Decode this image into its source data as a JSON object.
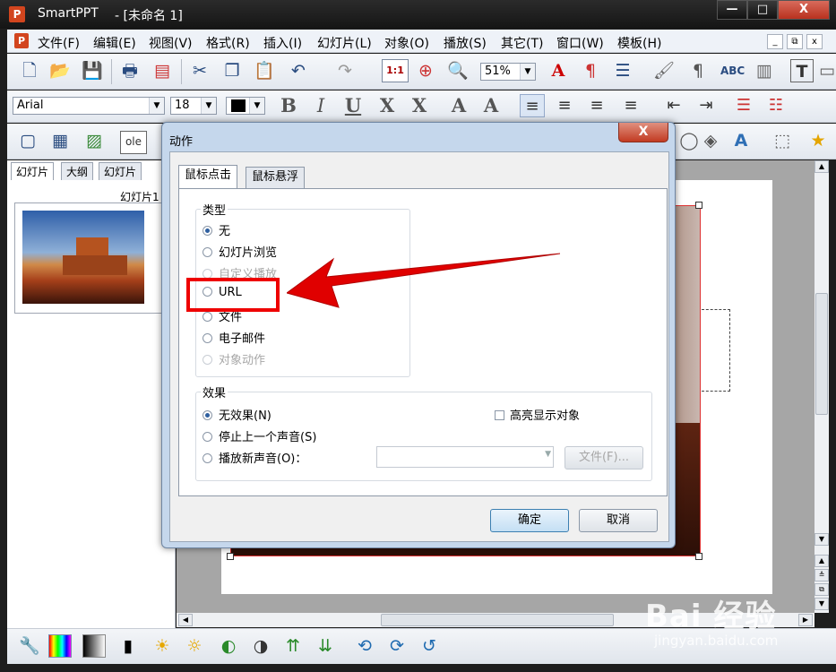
{
  "window": {
    "app_name": "SmartPPT",
    "doc_title": "- [未命名 1]",
    "logo_letter": "P",
    "minimize": "—",
    "maximize": "□",
    "close": "X"
  },
  "menu": {
    "items": [
      "文件(F)",
      "编辑(E)",
      "视图(V)",
      "格式(R)",
      "插入(I)",
      "幻灯片(L)",
      "对象(O)",
      "播放(S)",
      "其它(T)",
      "窗口(W)",
      "模板(H)"
    ],
    "mdi_buttons": [
      "_",
      "⧉",
      "x"
    ]
  },
  "toolbar": {
    "zoom": "51%",
    "font_name": "Arial",
    "font_size": "18",
    "one_to_one": "1:1",
    "ole": "ole"
  },
  "slide_pane": {
    "tabs": [
      "幻灯片",
      "大纲",
      "幻灯片"
    ],
    "slide_label": "幻灯片1"
  },
  "dialog": {
    "title": "动作",
    "close": "X",
    "tabs": [
      "鼠标点击",
      "鼠标悬浮"
    ],
    "type_group": {
      "title": "类型",
      "options": [
        {
          "label": "无",
          "selected": true,
          "enabled": true
        },
        {
          "label": "幻灯片浏览",
          "selected": false,
          "enabled": true
        },
        {
          "label": "自定义播放",
          "selected": false,
          "enabled": false
        },
        {
          "label": "URL",
          "selected": false,
          "enabled": true
        },
        {
          "label": "文件",
          "selected": false,
          "enabled": true
        },
        {
          "label": "电子邮件",
          "selected": false,
          "enabled": true
        },
        {
          "label": "对象动作",
          "selected": false,
          "enabled": false
        }
      ]
    },
    "effect_group": {
      "title": "效果",
      "options": [
        {
          "label": "无效果(N)",
          "selected": true
        },
        {
          "label": "停止上一个声音(S)",
          "selected": false
        },
        {
          "label": "播放新声音(O)：",
          "selected": false
        }
      ],
      "highlight_checkbox": "高亮显示对象",
      "file_button": "文件(F)..."
    },
    "ok_button": "确定",
    "cancel_button": "取消"
  },
  "watermark": {
    "text": "Bai 经验",
    "url": "jingyan.baidu.com"
  },
  "colors": {
    "highlight": "#e00000",
    "dialog_frame": "#c5d7ec",
    "title_bar": "#1e1e1e"
  }
}
